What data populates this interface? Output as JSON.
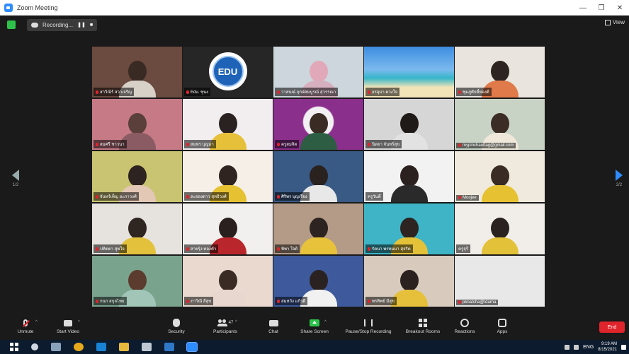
{
  "window": {
    "title": "Zoom Meeting",
    "minimize": "—",
    "maximize": "❐",
    "close": "✕"
  },
  "topbar": {
    "recording_label": "Recording...",
    "pause": "❚❚",
    "stop": "■",
    "view_label": "View"
  },
  "gallery": {
    "page_left": "1/2",
    "page_right": "2/2",
    "tiles": [
      {
        "name": "สาวิณีร์ สวาเจริญ",
        "muted": true,
        "kind": "room",
        "bg": "#6b4a3f",
        "head": "#3a2a24",
        "body": "#d8d1c8"
      },
      {
        "name": "Edu. ชุนง",
        "muted": true,
        "kind": "logo",
        "logo_text": "EDU"
      },
      {
        "name": "วาสนณ์ ฤกษ์สมบูรณ์ สุวรรณา",
        "muted": true,
        "kind": "person",
        "bg": "#cdd6dc",
        "head": "#e0a8b8",
        "body": "#d6b0be"
      },
      {
        "name": "อรอุมา ดวงใจ",
        "muted": true,
        "kind": "beach"
      },
      {
        "name": "ชุมภู่ศักดิ์ทองดี",
        "muted": true,
        "kind": "person",
        "bg": "#e9e4de",
        "head": "#2e2522",
        "body": "#e07a4a"
      },
      {
        "name": "สมศรี ชาวนา",
        "muted": true,
        "kind": "person",
        "bg": "#c67a86",
        "head": "#5a3f3b",
        "body": "#8a5b62"
      },
      {
        "name": "สมพร บุญมา",
        "muted": true,
        "kind": "person",
        "bg": "#f2eef0",
        "head": "#2a2121",
        "body": "#e7c03a"
      },
      {
        "name": "ครูสมจิต",
        "muted": true,
        "kind": "crest",
        "bg": "#8b2f8c",
        "head": "#3a2b24",
        "body": "#2d5d43"
      },
      {
        "name": "นิตยา จันทร์สุข",
        "muted": true,
        "kind": "person",
        "bg": "#d6d6d6",
        "head": "#1f1a18",
        "body": "#e2e2e2"
      },
      {
        "name": "mypinchauttag@gmail.com",
        "muted": true,
        "kind": "person",
        "bg": "#c8d2c5",
        "head": "#3b2c26",
        "body": "#efe8da"
      },
      {
        "name": "จันทร์เพ็ญ ยะภาวงศ์",
        "muted": true,
        "kind": "person",
        "bg": "#c9c471",
        "head": "#2d2320",
        "body": "#e3c8b5"
      },
      {
        "name": "ละอองดาว สุทธิวงศ์",
        "muted": true,
        "kind": "person",
        "bg": "#f5efe7",
        "head": "#2f241f",
        "body": "#e6c232"
      },
      {
        "name": "ศิริพร บุญเรือง",
        "muted": true,
        "kind": "person",
        "bg": "#3a5a86",
        "head": "#2a221f",
        "body": "#e8e8e8"
      },
      {
        "name": "ครูวันดี",
        "muted": false,
        "kind": "person",
        "active": true,
        "bg": "#f2f2f2",
        "head": "#2b2220",
        "body": "#2a2a2a"
      },
      {
        "name": "Moojee",
        "muted": true,
        "kind": "person",
        "bg": "#f0eade",
        "head": "#3a2b24",
        "body": "#e6c232"
      },
      {
        "name": "ปทิตตา สุขใจ",
        "muted": true,
        "kind": "person",
        "bg": "#e6e2de",
        "head": "#2f2521",
        "body": "#e3c13c"
      },
      {
        "name": "สายรุ้ง ทองคำ",
        "muted": true,
        "kind": "person",
        "bg": "#f2f0ee",
        "head": "#2a201d",
        "body": "#b9272c"
      },
      {
        "name": "ทิพา ใจดี",
        "muted": true,
        "kind": "person",
        "bg": "#b49b88",
        "head": "#2d2320",
        "body": "#e7c23a"
      },
      {
        "name": "รัตนา พรหมมา สุจริต",
        "muted": true,
        "kind": "person",
        "bg": "#3eb4c6",
        "head": "#2d2320",
        "body": "#e3c23a"
      },
      {
        "name": "ครูจุรี",
        "muted": false,
        "kind": "person",
        "bg": "#f1ede9",
        "head": "#2a2220",
        "body": "#e3c23a"
      },
      {
        "name": "กนก สกุลไทย",
        "muted": true,
        "kind": "room",
        "bg": "#7aa38e",
        "head": "#5b3c2e",
        "body": "#a1c5b6"
      },
      {
        "name": "ภาวิณี สีสุข",
        "muted": true,
        "kind": "person",
        "bg": "#e9d9cf",
        "head": "#3a2b24",
        "body": "#e7d7cf"
      },
      {
        "name": "สมหวัง แก้วดี",
        "muted": true,
        "kind": "person",
        "bg": "#3e5a9c",
        "head": "#2a2220",
        "body": "#f1f1f1"
      },
      {
        "name": "พรทิพย์ มีสุข",
        "muted": true,
        "kind": "person",
        "bg": "#d8cbbd",
        "head": "#2b2220",
        "body": "#e6c03a"
      },
      {
        "name": "pknatcha@tdarna",
        "muted": true,
        "kind": "person",
        "bg": "#e8e8e8",
        "head": "#e8e8e8",
        "body": "#e8e8e8"
      }
    ]
  },
  "toolbar": {
    "unmute": "Unmute",
    "start_video": "Start Video",
    "security": "Security",
    "participants": "Participants",
    "participants_count": "47",
    "chat": "Chat",
    "share_screen": "Share Screen",
    "pause_recording": "Pause/Stop Recording",
    "breakout_rooms": "Breakout Rooms",
    "reactions": "Reactions",
    "apps": "Apps",
    "end": "End"
  },
  "taskbar": {
    "lang": "ENG",
    "time": "9:19 AM",
    "date": "8/15/2021"
  },
  "colors": {
    "accent_green": "#2ec24a",
    "end_red": "#e0242b",
    "zoom_blue": "#2d8cff",
    "active_speaker": "#8fd13d"
  }
}
